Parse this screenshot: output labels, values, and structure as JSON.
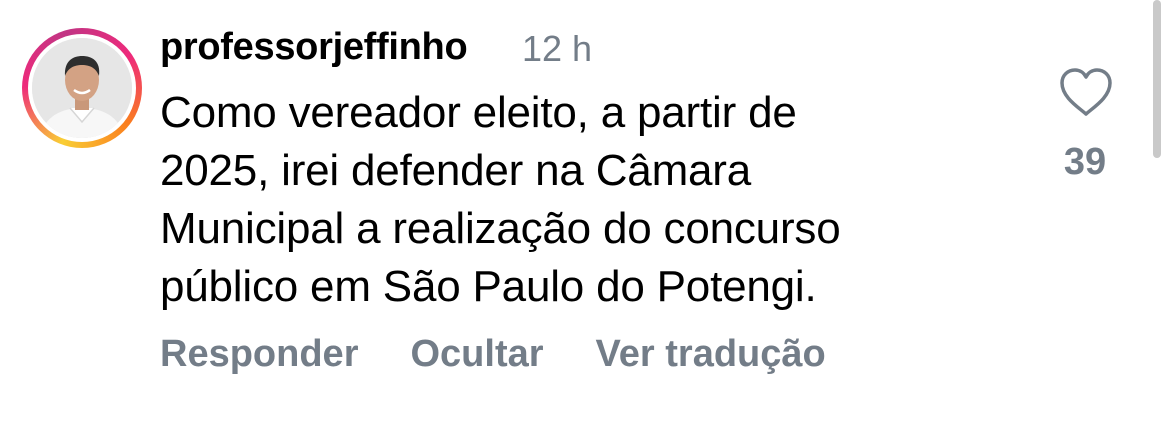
{
  "comment": {
    "username": "professorjeffinho",
    "timestamp": "12 h",
    "text_lines": [
      "Como vereador eleito, a partir de",
      "2025, irei defender na Câmara",
      "Municipal a realização do concurso",
      "público em São Paulo do Potengi."
    ],
    "like_count": "39",
    "like_icon": "heart-outline-icon"
  },
  "actions": {
    "reply_label": "Responder",
    "hide_label": "Ocultar",
    "translate_label": "Ver tradução"
  },
  "colors": {
    "text": "#000000",
    "secondary": "#737d88",
    "story_ring": [
      "#f9ce34",
      "#ee2a7b",
      "#c13584",
      "#fa7e1e"
    ]
  }
}
